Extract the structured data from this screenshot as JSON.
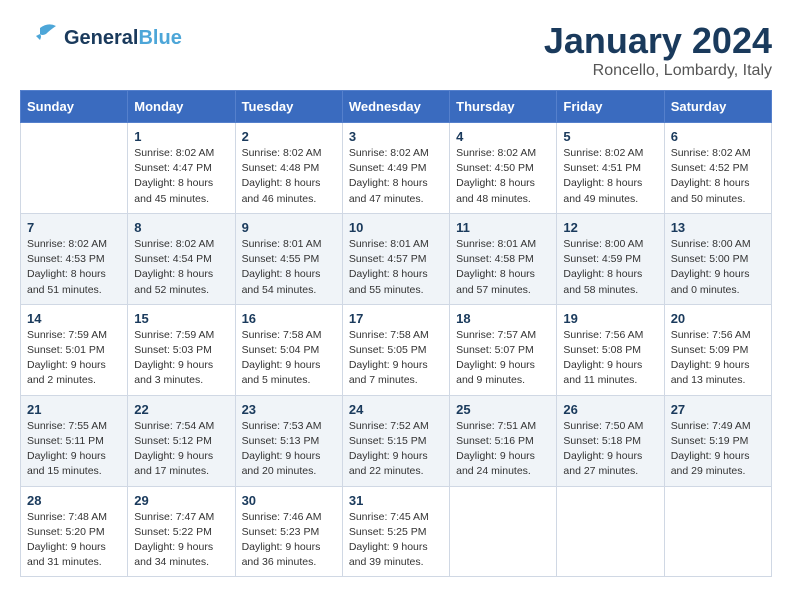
{
  "header": {
    "logo_line1": "General",
    "logo_line2": "Blue",
    "month": "January 2024",
    "location": "Roncello, Lombardy, Italy"
  },
  "days_of_week": [
    "Sunday",
    "Monday",
    "Tuesday",
    "Wednesday",
    "Thursday",
    "Friday",
    "Saturday"
  ],
  "weeks": [
    [
      {
        "day": "",
        "info": ""
      },
      {
        "day": "1",
        "info": "Sunrise: 8:02 AM\nSunset: 4:47 PM\nDaylight: 8 hours\nand 45 minutes."
      },
      {
        "day": "2",
        "info": "Sunrise: 8:02 AM\nSunset: 4:48 PM\nDaylight: 8 hours\nand 46 minutes."
      },
      {
        "day": "3",
        "info": "Sunrise: 8:02 AM\nSunset: 4:49 PM\nDaylight: 8 hours\nand 47 minutes."
      },
      {
        "day": "4",
        "info": "Sunrise: 8:02 AM\nSunset: 4:50 PM\nDaylight: 8 hours\nand 48 minutes."
      },
      {
        "day": "5",
        "info": "Sunrise: 8:02 AM\nSunset: 4:51 PM\nDaylight: 8 hours\nand 49 minutes."
      },
      {
        "day": "6",
        "info": "Sunrise: 8:02 AM\nSunset: 4:52 PM\nDaylight: 8 hours\nand 50 minutes."
      }
    ],
    [
      {
        "day": "7",
        "info": "Sunrise: 8:02 AM\nSunset: 4:53 PM\nDaylight: 8 hours\nand 51 minutes."
      },
      {
        "day": "8",
        "info": "Sunrise: 8:02 AM\nSunset: 4:54 PM\nDaylight: 8 hours\nand 52 minutes."
      },
      {
        "day": "9",
        "info": "Sunrise: 8:01 AM\nSunset: 4:55 PM\nDaylight: 8 hours\nand 54 minutes."
      },
      {
        "day": "10",
        "info": "Sunrise: 8:01 AM\nSunset: 4:57 PM\nDaylight: 8 hours\nand 55 minutes."
      },
      {
        "day": "11",
        "info": "Sunrise: 8:01 AM\nSunset: 4:58 PM\nDaylight: 8 hours\nand 57 minutes."
      },
      {
        "day": "12",
        "info": "Sunrise: 8:00 AM\nSunset: 4:59 PM\nDaylight: 8 hours\nand 58 minutes."
      },
      {
        "day": "13",
        "info": "Sunrise: 8:00 AM\nSunset: 5:00 PM\nDaylight: 9 hours\nand 0 minutes."
      }
    ],
    [
      {
        "day": "14",
        "info": "Sunrise: 7:59 AM\nSunset: 5:01 PM\nDaylight: 9 hours\nand 2 minutes."
      },
      {
        "day": "15",
        "info": "Sunrise: 7:59 AM\nSunset: 5:03 PM\nDaylight: 9 hours\nand 3 minutes."
      },
      {
        "day": "16",
        "info": "Sunrise: 7:58 AM\nSunset: 5:04 PM\nDaylight: 9 hours\nand 5 minutes."
      },
      {
        "day": "17",
        "info": "Sunrise: 7:58 AM\nSunset: 5:05 PM\nDaylight: 9 hours\nand 7 minutes."
      },
      {
        "day": "18",
        "info": "Sunrise: 7:57 AM\nSunset: 5:07 PM\nDaylight: 9 hours\nand 9 minutes."
      },
      {
        "day": "19",
        "info": "Sunrise: 7:56 AM\nSunset: 5:08 PM\nDaylight: 9 hours\nand 11 minutes."
      },
      {
        "day": "20",
        "info": "Sunrise: 7:56 AM\nSunset: 5:09 PM\nDaylight: 9 hours\nand 13 minutes."
      }
    ],
    [
      {
        "day": "21",
        "info": "Sunrise: 7:55 AM\nSunset: 5:11 PM\nDaylight: 9 hours\nand 15 minutes."
      },
      {
        "day": "22",
        "info": "Sunrise: 7:54 AM\nSunset: 5:12 PM\nDaylight: 9 hours\nand 17 minutes."
      },
      {
        "day": "23",
        "info": "Sunrise: 7:53 AM\nSunset: 5:13 PM\nDaylight: 9 hours\nand 20 minutes."
      },
      {
        "day": "24",
        "info": "Sunrise: 7:52 AM\nSunset: 5:15 PM\nDaylight: 9 hours\nand 22 minutes."
      },
      {
        "day": "25",
        "info": "Sunrise: 7:51 AM\nSunset: 5:16 PM\nDaylight: 9 hours\nand 24 minutes."
      },
      {
        "day": "26",
        "info": "Sunrise: 7:50 AM\nSunset: 5:18 PM\nDaylight: 9 hours\nand 27 minutes."
      },
      {
        "day": "27",
        "info": "Sunrise: 7:49 AM\nSunset: 5:19 PM\nDaylight: 9 hours\nand 29 minutes."
      }
    ],
    [
      {
        "day": "28",
        "info": "Sunrise: 7:48 AM\nSunset: 5:20 PM\nDaylight: 9 hours\nand 31 minutes."
      },
      {
        "day": "29",
        "info": "Sunrise: 7:47 AM\nSunset: 5:22 PM\nDaylight: 9 hours\nand 34 minutes."
      },
      {
        "day": "30",
        "info": "Sunrise: 7:46 AM\nSunset: 5:23 PM\nDaylight: 9 hours\nand 36 minutes."
      },
      {
        "day": "31",
        "info": "Sunrise: 7:45 AM\nSunset: 5:25 PM\nDaylight: 9 hours\nand 39 minutes."
      },
      {
        "day": "",
        "info": ""
      },
      {
        "day": "",
        "info": ""
      },
      {
        "day": "",
        "info": ""
      }
    ]
  ]
}
